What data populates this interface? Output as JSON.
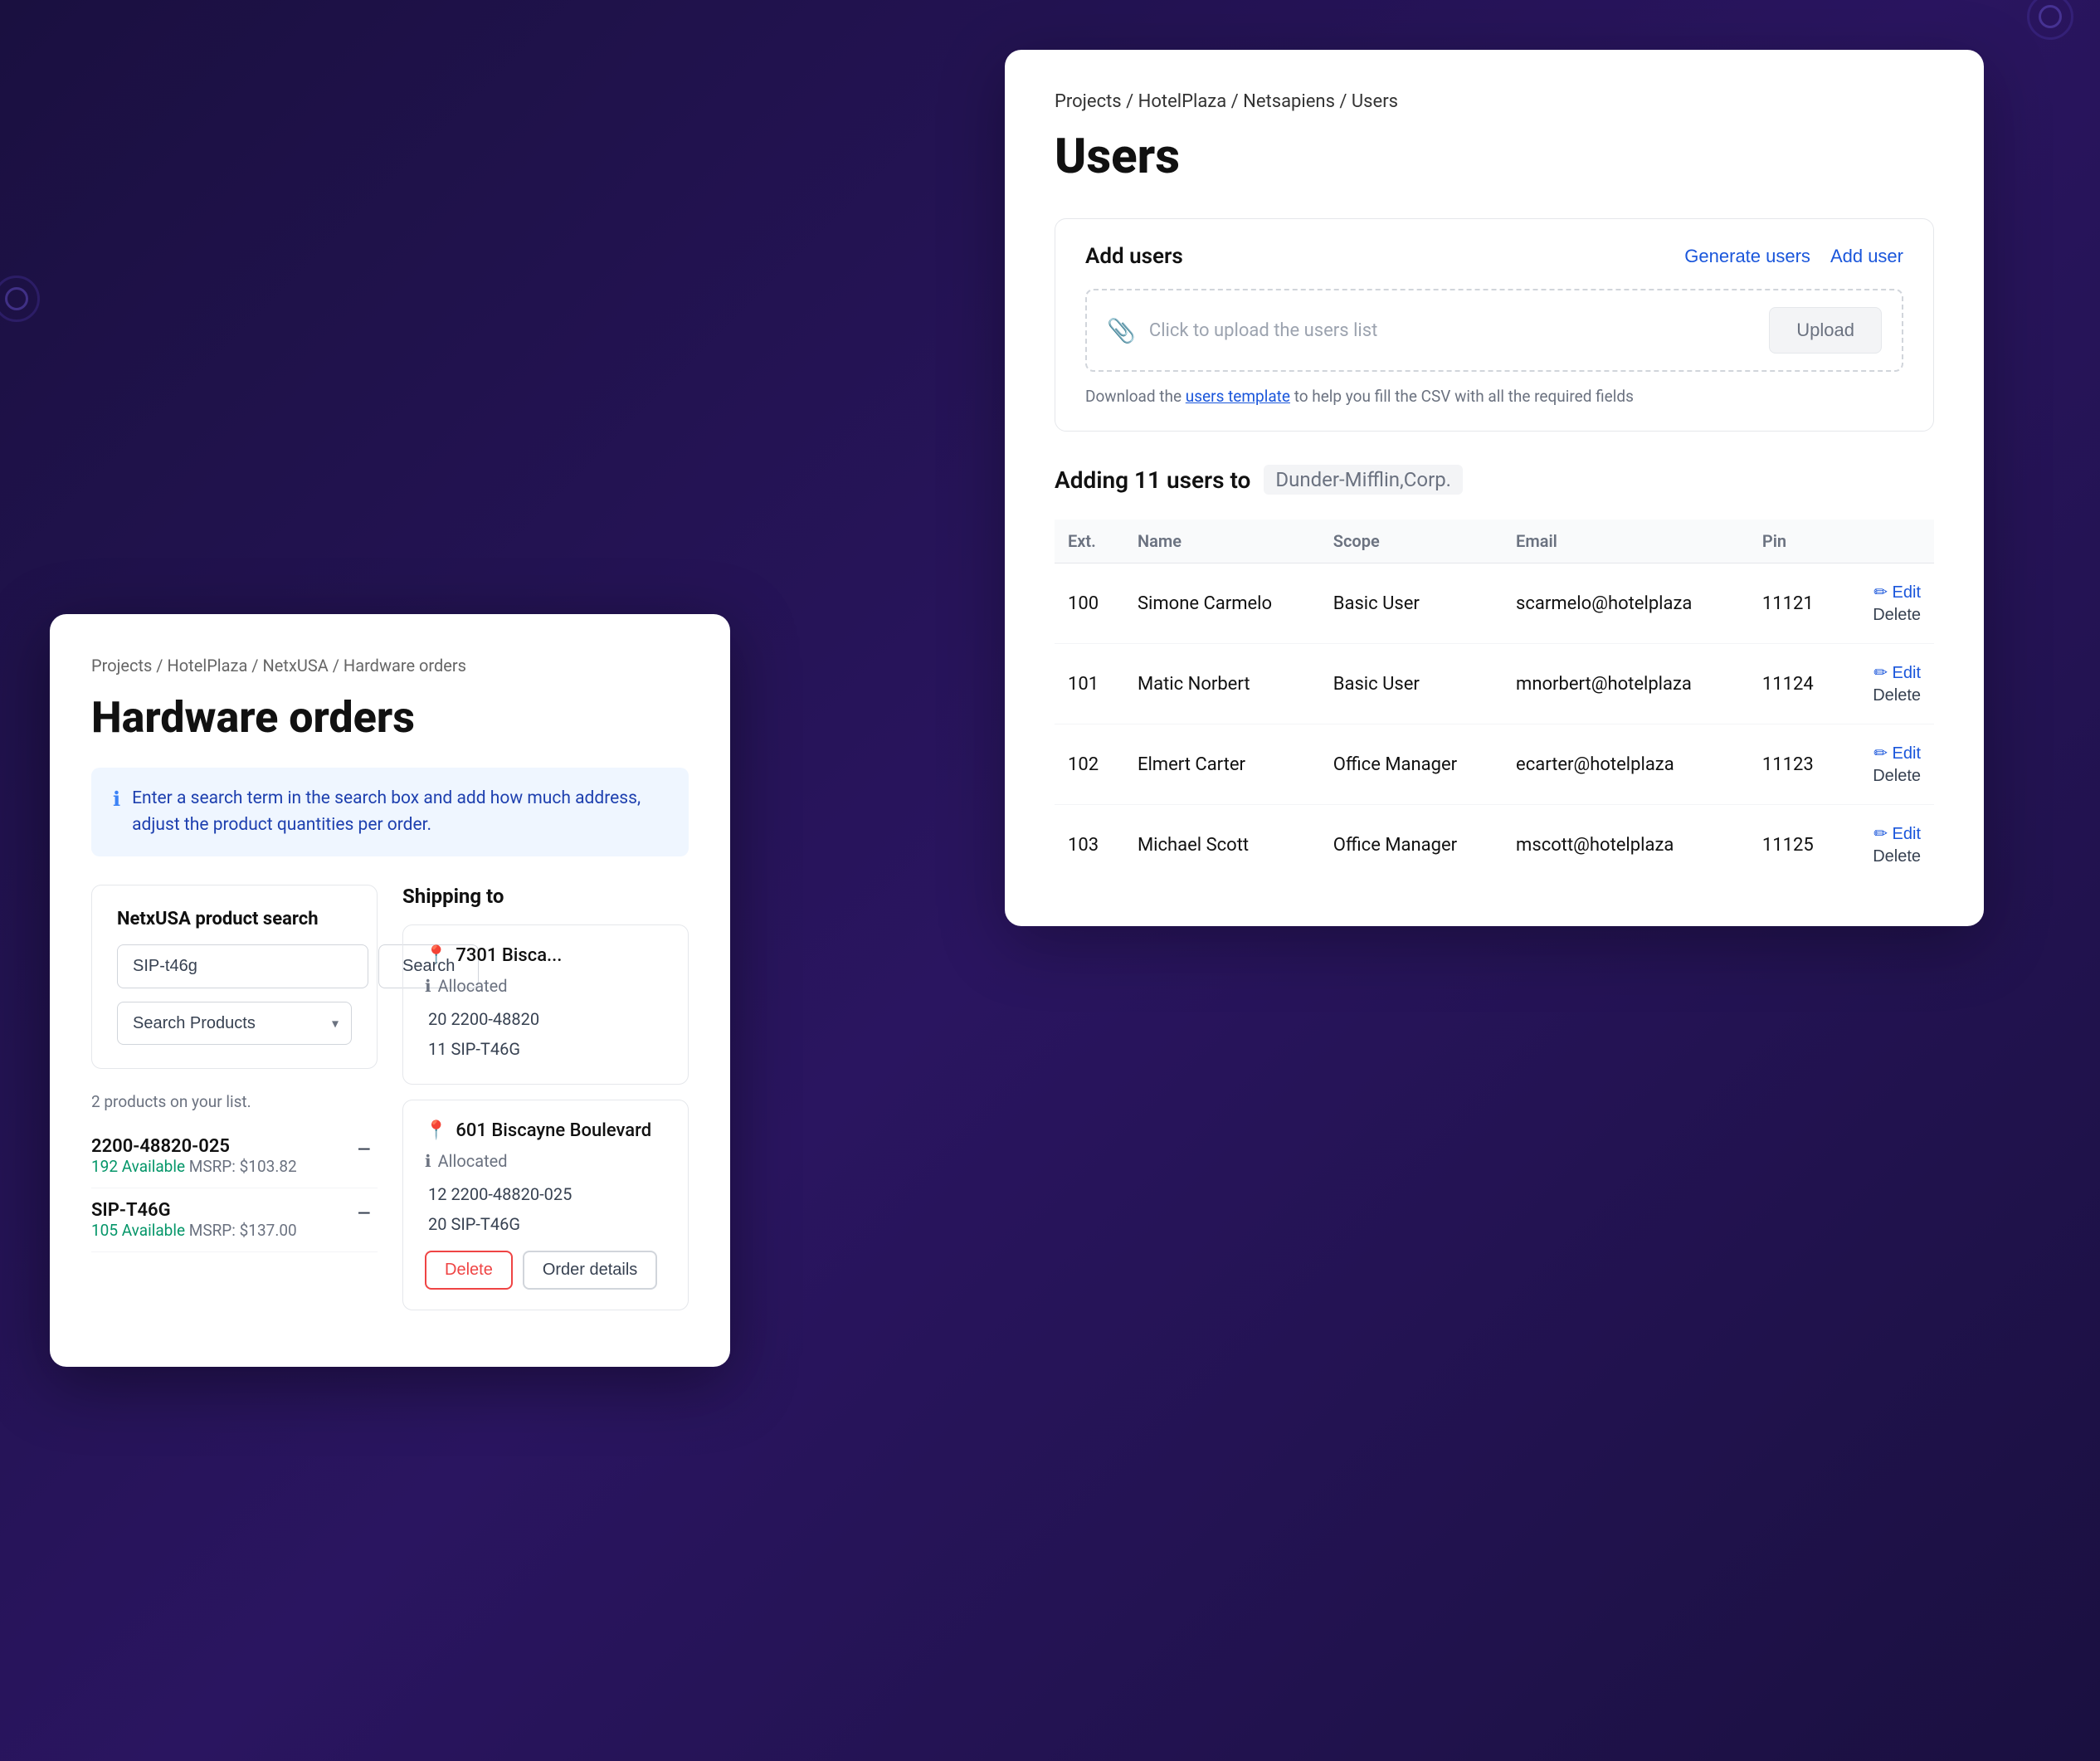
{
  "users_panel": {
    "breadcrumb": {
      "items": [
        "Projects",
        "HotelPlaza",
        "Netsapiens",
        "Users"
      ],
      "text": "Projects / HotelPlaza / Netsapiens / Users"
    },
    "title": "Users",
    "add_users": {
      "title": "Add users",
      "generate_users_label": "Generate users",
      "add_user_label": "Add user",
      "upload_placeholder": "Click to upload the users list",
      "upload_btn_label": "Upload",
      "download_hint": "Download the",
      "download_link_label": "users template",
      "download_hint2": "to help you fill the CSV with all the required fields"
    },
    "adding_label": "Adding 11 users to",
    "company_name": "Dunder-Mifflin,Corp.",
    "table": {
      "headers": [
        "Ext.",
        "Name",
        "Scope",
        "Email",
        "Pin",
        ""
      ],
      "rows": [
        {
          "ext": "100",
          "name": "Simone Carmelo",
          "scope": "Basic User",
          "email": "scarmelo@hotelplaza",
          "pin": "11121"
        },
        {
          "ext": "101",
          "name": "Matic Norbert",
          "scope": "Basic User",
          "email": "mnorbert@hotelplaza",
          "pin": "11124"
        },
        {
          "ext": "102",
          "name": "Elmert Carter",
          "scope": "Office Manager",
          "email": "ecarter@hotelplaza",
          "pin": "11123"
        },
        {
          "ext": "103",
          "name": "Michael Scott",
          "scope": "Office Manager",
          "email": "mscott@hotelplaza",
          "pin": "11125"
        }
      ],
      "edit_label": "Edit",
      "delete_label": "Delete"
    }
  },
  "hardware_panel": {
    "breadcrumb": "Projects / HotelPlaza / NetxUSA / Hardware orders",
    "title": "Hardware orders",
    "info_text": "Enter a search term in the search box and add how much address, adjust the product quantities per order.",
    "product_search": {
      "title": "NetxUSA product search",
      "search_value": "SIP-t46g",
      "search_btn_label": "Search",
      "category_placeholder": "Search Products"
    },
    "products_count": "2 products on your list.",
    "products": [
      {
        "name": "2200-48820-025",
        "available": "192 Available",
        "msrp": "MSRP: $103.82"
      },
      {
        "name": "SIP-T46G",
        "available": "105 Available",
        "msrp": "MSRP: $137.00"
      }
    ],
    "shipping_to_label": "Shipping to",
    "shipping_cards": [
      {
        "address": "7301 Bisca...",
        "allocated_label": "Allocated",
        "items": [
          "20 2200-48820",
          "11 SIP-T46G"
        ]
      },
      {
        "address": "601 Biscayne Boulevard",
        "allocated_label": "Allocated",
        "items": [
          "12 2200-48820-025",
          "20 SIP-T46G"
        ],
        "delete_btn_label": "Delete",
        "order_details_label": "Order details"
      }
    ]
  },
  "tooltip": {
    "items": [
      "20 2200-48820",
      "11 SIP-T46G"
    ]
  },
  "icons": {
    "paperclip": "📎",
    "info": "ℹ",
    "location": "📍",
    "pencil": "✏"
  }
}
